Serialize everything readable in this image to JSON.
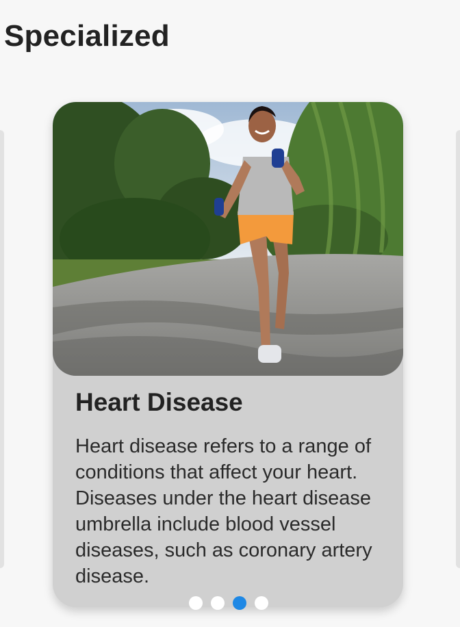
{
  "section": {
    "title": "Specialized"
  },
  "card": {
    "title": "Heart Disease",
    "description": "Heart disease refers to a range of conditions that affect your heart. Diseases under the heart disease umbrella include blood vessel diseases, such as coronary artery disease.",
    "image_alt": "Woman jogging with dumbbells in a park"
  },
  "pagination": {
    "count": 4,
    "active_index": 2,
    "active_color": "#1e88e5",
    "inactive_color": "#ffffff"
  }
}
